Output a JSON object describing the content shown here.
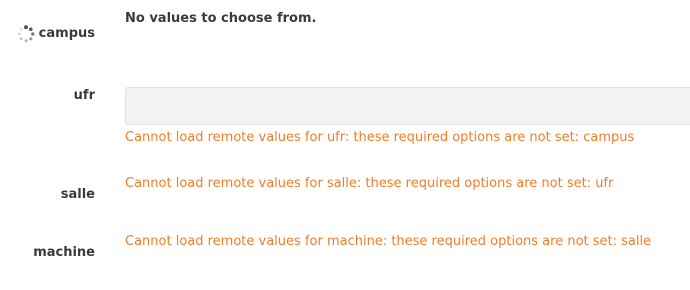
{
  "fields": {
    "campus": {
      "label": "campus",
      "message": "No values to choose from.",
      "icon": "loading-spinner-icon"
    },
    "ufr": {
      "label": "ufr",
      "value": "",
      "error": "Cannot load remote values for ufr: these required options are not set: campus"
    },
    "salle": {
      "label": "salle",
      "error": "Cannot load remote values for salle: these required options are not set: ufr"
    },
    "machine": {
      "label": "machine",
      "error": "Cannot load remote values for machine: these required options are not set: salle"
    }
  },
  "colors": {
    "label": "#3b3b3b",
    "error": "#f07d28",
    "input_bg": "#f2f2f2"
  }
}
